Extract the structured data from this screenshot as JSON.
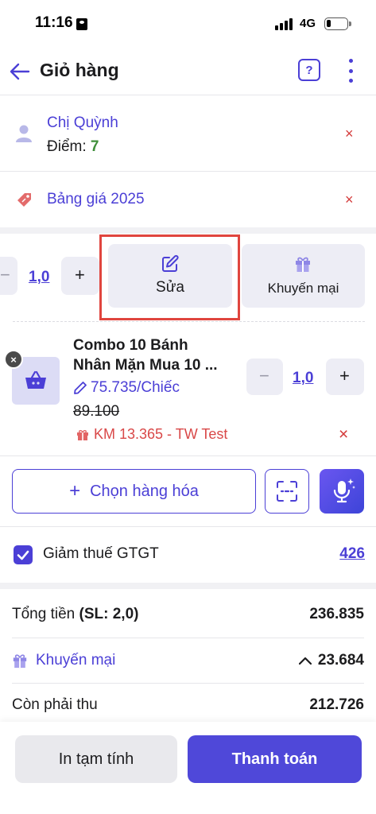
{
  "status_bar": {
    "time": "11:16",
    "network": "4G"
  },
  "header": {
    "title": "Giỏ hàng",
    "help_label": "?"
  },
  "customer": {
    "name": "Chị Quỳnh",
    "points_label": "Điểm:",
    "points_value": "7"
  },
  "price_list": {
    "label": "Bảng giá 2025"
  },
  "top_item": {
    "quantity": "1,0",
    "plus": "+",
    "minus": "−"
  },
  "actions": {
    "edit_label": "Sửa",
    "promo_label": "Khuyến mại"
  },
  "product": {
    "name_line1": "Combo 10 Bánh",
    "name_line2": "Nhân Mặn Mua 10 ...",
    "price": "75.735/Chiếc",
    "old_price": "89.100",
    "promo": "KM 13.365 - TW Test",
    "quantity": "1,0",
    "minus": "−",
    "plus": "+",
    "remove_symbol": "×"
  },
  "add_items": {
    "choose_label": "Chọn hàng hóa",
    "plus": "+"
  },
  "vat": {
    "label": "Giảm thuế GTGT",
    "value": "426",
    "checked": true
  },
  "summary": {
    "total_label": "Tổng tiền",
    "total_qty": "(SL: 2,0)",
    "total_value": "236.835",
    "promo_label": "Khuyến mại",
    "promo_value": "23.684",
    "due_label": "Còn phải thu",
    "due_value": "212.726"
  },
  "bottom": {
    "print_label": "In tạm tính",
    "pay_label": "Thanh toán"
  },
  "icons": {
    "back": "arrow-left-icon",
    "help": "question-icon",
    "more": "more-vertical-icon",
    "user": "user-icon",
    "tag": "price-tag-icon",
    "edit": "edit-icon",
    "gift": "gift-icon",
    "basket": "basket-icon",
    "scan": "scan-icon",
    "mic": "mic-icon",
    "close": "close-icon"
  },
  "colors": {
    "accent": "#4b3fd6",
    "danger": "#d43b3b",
    "points": "#3f8f3a",
    "highlight": "#e0453e",
    "pay": "#4f48d9"
  },
  "x_symbol": "×"
}
